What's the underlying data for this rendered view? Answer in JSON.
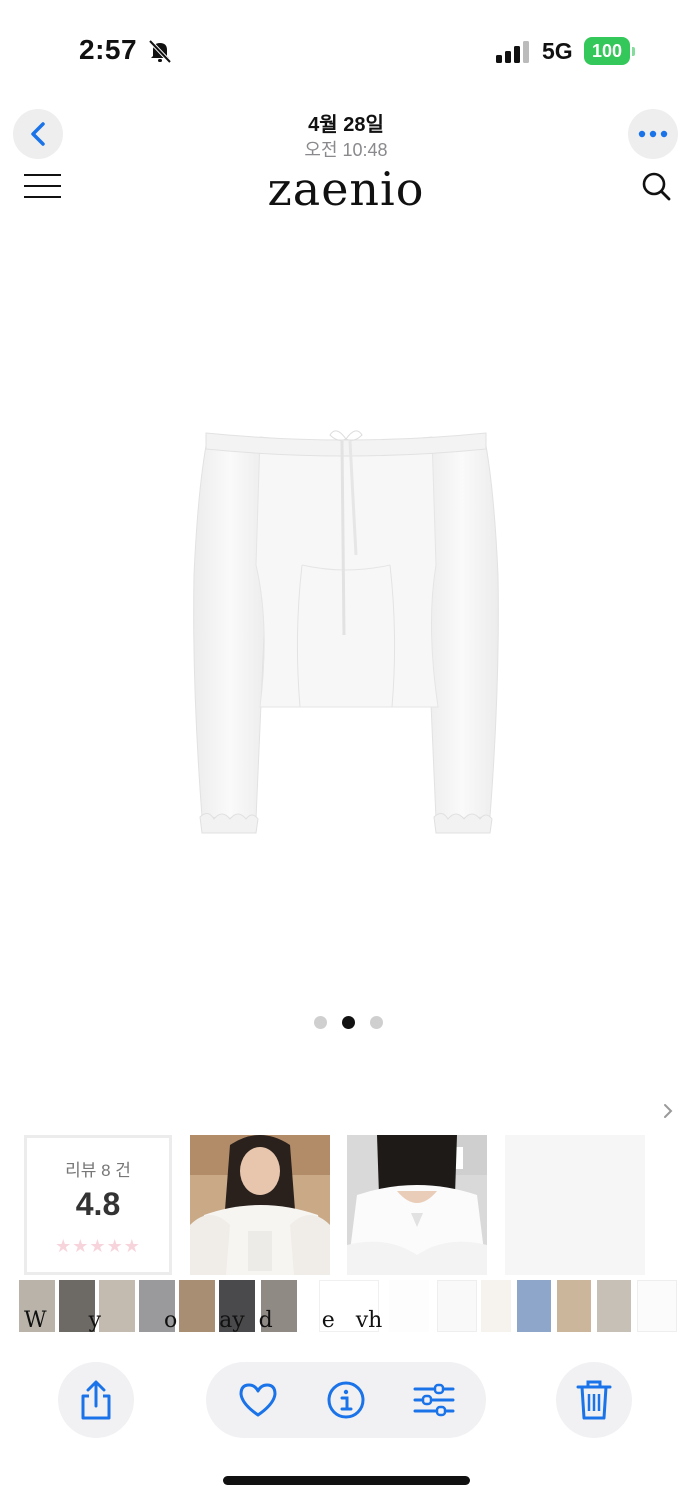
{
  "status_bar": {
    "time": "2:57",
    "network": "5G",
    "battery": "100"
  },
  "photo_header": {
    "date": "4월 28일",
    "time": "오전 10:48"
  },
  "site": {
    "logo": "zaenio"
  },
  "carousel": {
    "total": 3,
    "active_index": 1
  },
  "reviews": {
    "count_label": "리뷰 8 건",
    "rating": "4.8",
    "stars": "★★★★★"
  },
  "filmstrip": {
    "overlay_text": "W      y         o      ay  d       e   vh"
  },
  "colors": {
    "accent": "#1a73e8",
    "battery": "#34c759",
    "star": "#f7d4dc"
  },
  "toolbar": {
    "share_icon": "share-icon",
    "favorite_icon": "heart-icon",
    "info_icon": "info-icon",
    "adjust_icon": "sliders-icon",
    "delete_icon": "trash-icon"
  }
}
